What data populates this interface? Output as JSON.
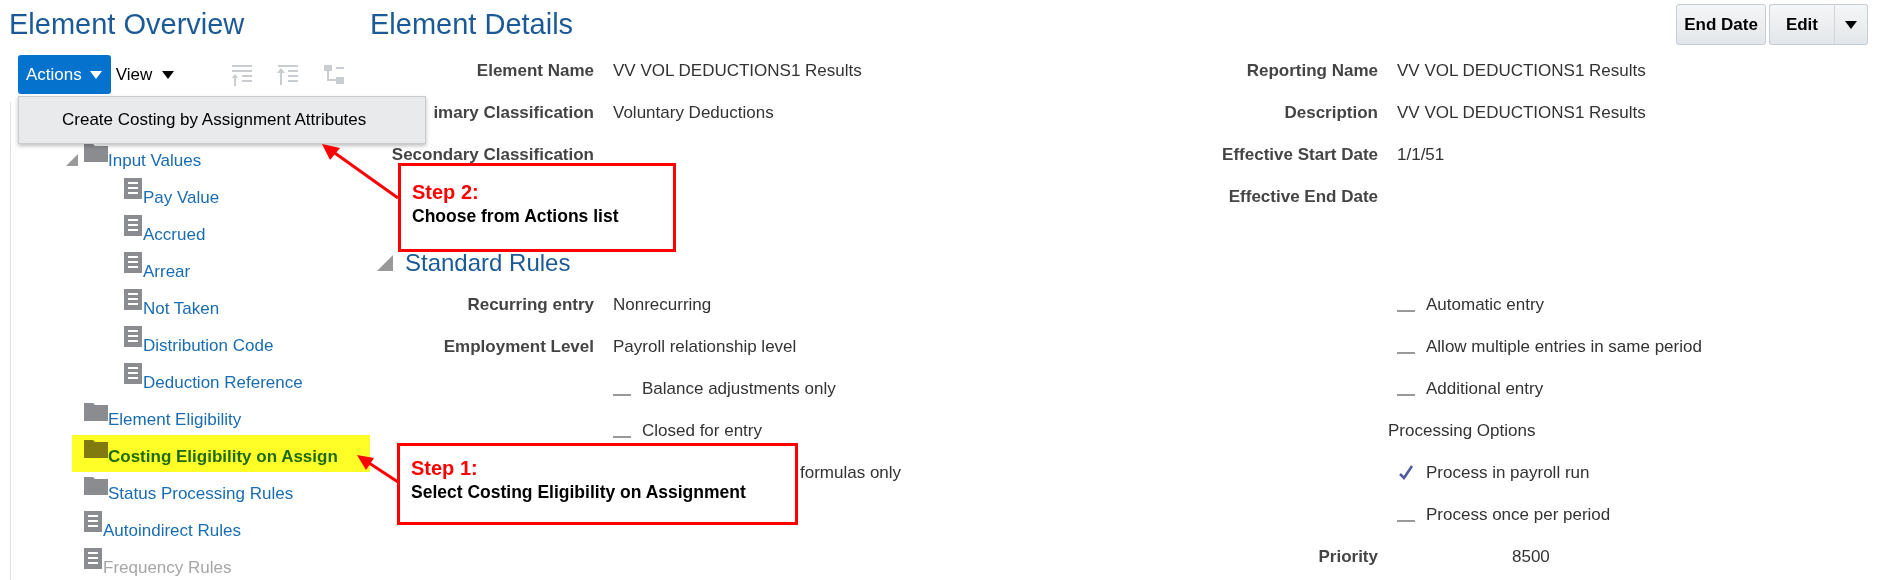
{
  "overview": {
    "title": "Element Overview",
    "toolbar": {
      "actions": "Actions",
      "view": "View"
    },
    "actions_menu": {
      "items": [
        "Create Costing by Assignment Attributes"
      ]
    },
    "tree": [
      {
        "label": "Input Values",
        "kind": "folder",
        "expanded": true,
        "selected": false,
        "disabled": false,
        "children": [
          {
            "label": "Pay Value",
            "kind": "page",
            "selected": false,
            "disabled": false
          },
          {
            "label": "Accrued",
            "kind": "page",
            "selected": false,
            "disabled": false
          },
          {
            "label": "Arrear",
            "kind": "page",
            "selected": false,
            "disabled": false
          },
          {
            "label": "Not Taken",
            "kind": "page",
            "selected": false,
            "disabled": false
          },
          {
            "label": "Distribution Code",
            "kind": "page",
            "selected": false,
            "disabled": false
          },
          {
            "label": "Deduction Reference",
            "kind": "page",
            "selected": false,
            "disabled": false
          }
        ]
      },
      {
        "label": "Element Eligibility",
        "kind": "folder",
        "selected": false,
        "disabled": false
      },
      {
        "label": "Costing Eligibility on Assign",
        "kind": "folder",
        "selected": true,
        "disabled": false
      },
      {
        "label": "Status Processing Rules",
        "kind": "folder",
        "selected": false,
        "disabled": false
      },
      {
        "label": "Autoindirect Rules",
        "kind": "page",
        "selected": false,
        "disabled": false
      },
      {
        "label": "Frequency Rules",
        "kind": "page",
        "selected": false,
        "disabled": true
      }
    ]
  },
  "details": {
    "title": "Element Details",
    "buttons": {
      "end_date": "End Date",
      "edit": "Edit"
    },
    "left_fields": [
      {
        "label": "Element Name",
        "value": "VV VOL DEDUCTIONS1 Results"
      },
      {
        "label": "imary Classification",
        "value": "Voluntary Deductions"
      },
      {
        "label": "Secondary Classification"
      }
    ],
    "right_fields": [
      {
        "label": "Reporting Name",
        "value": "VV VOL DEDUCTIONS1 Results"
      },
      {
        "label": "Description",
        "value": "VV VOL DEDUCTIONS1 Results"
      },
      {
        "label": "Effective Start Date",
        "value": "1/1/51"
      },
      {
        "label": "Effective End Date"
      }
    ]
  },
  "standard_rules": {
    "title": "Standard Rules",
    "expanded": true,
    "fields": [
      {
        "label": "Recurring entry",
        "value": "Nonrecurring"
      },
      {
        "label": "Employment Level",
        "value": "Payroll relationship level"
      }
    ],
    "left_options": [
      {
        "label": "Balance adjustments only",
        "kind": "option",
        "checked": false
      },
      {
        "label": "Closed for entry",
        "kind": "option",
        "checked": false
      },
      {
        "label": "formulas only",
        "kind": "covered"
      }
    ],
    "right_options": [
      {
        "label": "Automatic entry",
        "checked": false
      },
      {
        "label": "Allow multiple entries in same period",
        "checked": false
      },
      {
        "label": "Additional entry",
        "checked": false
      }
    ],
    "processing_options": {
      "title": "Processing Options",
      "options": [
        {
          "label": "Process in payroll run",
          "checked": true
        },
        {
          "label": "Process once per period",
          "checked": false
        }
      ]
    },
    "priority": {
      "label": "Priority",
      "value": "8500"
    }
  },
  "callouts": [
    {
      "step": "Step 2:",
      "text": "Choose from Actions list"
    },
    {
      "step": "Step 1:",
      "text": "Select Costing Eligibility on Assignment"
    }
  ]
}
